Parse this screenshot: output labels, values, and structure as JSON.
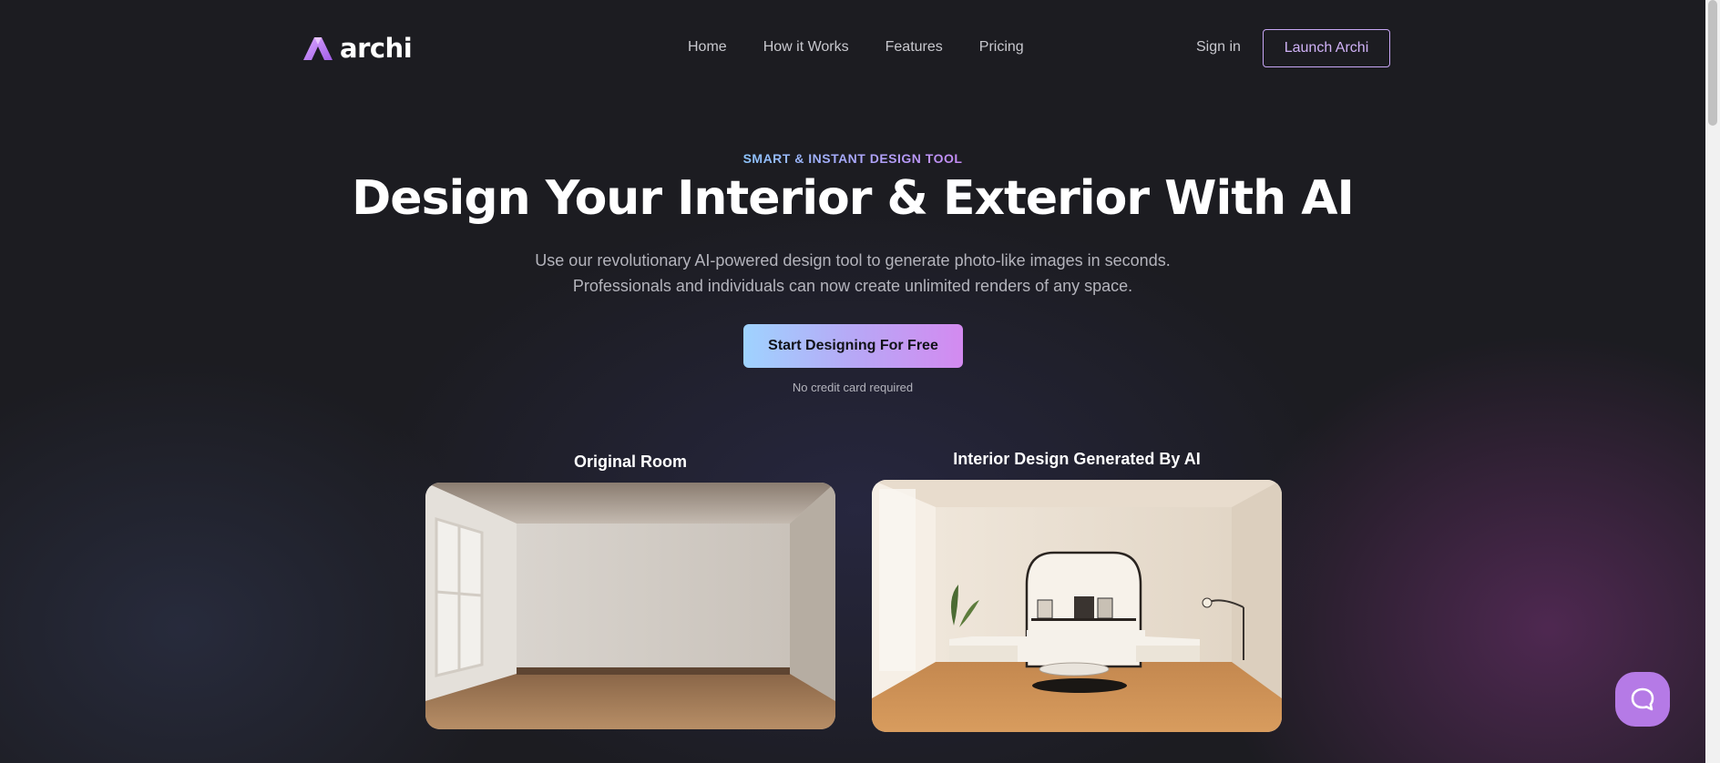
{
  "brand": {
    "name": "archi",
    "logo_icon": "archi-a-mark-icon",
    "accent": "#b57ae6"
  },
  "nav": {
    "links": [
      "Home",
      "How it Works",
      "Features",
      "Pricing"
    ],
    "signin": "Sign in",
    "launch": "Launch Archi"
  },
  "hero": {
    "eyebrow": "SMART & INSTANT DESIGN TOOL",
    "headline": "Design Your Interior & Exterior With AI",
    "sub_line1": "Use our revolutionary AI-powered design tool to generate photo-like images in seconds.",
    "sub_line2": "Professionals and individuals can now create unlimited renders of any space.",
    "cta": "Start Designing For Free",
    "note": "No credit card required"
  },
  "comparison": {
    "left_caption": "Original Room",
    "right_caption": "Interior Design Generated By AI"
  },
  "chat": {
    "icon": "chat-bubble-icon"
  }
}
